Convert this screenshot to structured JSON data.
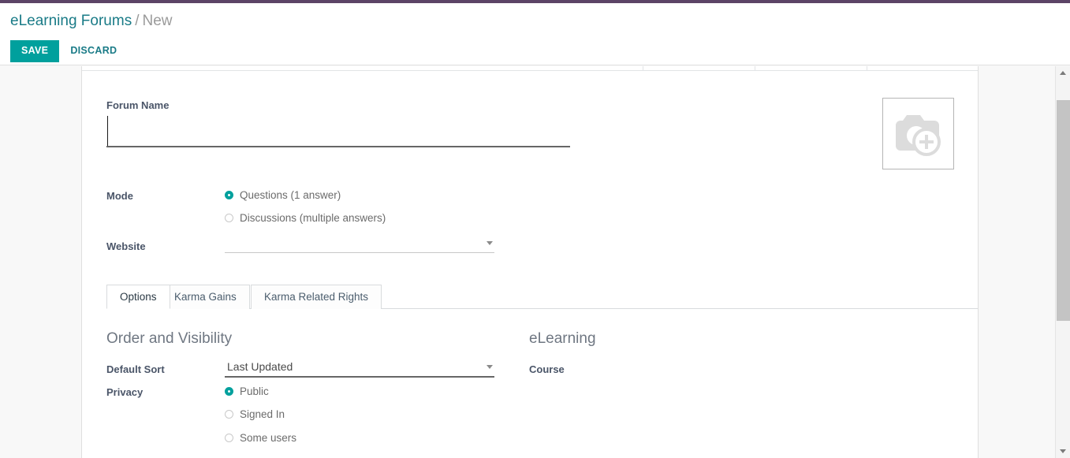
{
  "breadcrumb": {
    "root": "eLearning Forums",
    "separator": "/",
    "current": "New"
  },
  "control_panel": {
    "save_label": "SAVE",
    "discard_label": "DISCARD"
  },
  "colors": {
    "accent_teal": "#00a09d",
    "link_teal": "#1a7b87",
    "navbar_purple": "#5c4466",
    "label_gray": "#4a5568",
    "muted_gray": "#9a9a9a",
    "sheet_white": "#ffffff",
    "page_gray": "#f8f8f8"
  },
  "image_field": {
    "icon": "camera-plus-placeholder-icon",
    "alt": "Add image"
  },
  "form": {
    "name_label": "Forum Name",
    "name_value": "",
    "name_placeholder": "",
    "mode_label": "Mode",
    "mode_options": [
      {
        "label": "Questions (1 answer)",
        "selected": true
      },
      {
        "label": "Discussions (multiple answers)",
        "selected": false
      }
    ],
    "website_label": "Website",
    "website_value": "",
    "website_caret_icon": "chevron-down-icon"
  },
  "notebook": {
    "tabs": [
      {
        "label": "Options",
        "active": true
      },
      {
        "label": "Karma Gains",
        "active": false
      },
      {
        "label": "Karma Related Rights",
        "active": false
      }
    ]
  },
  "options_tab": {
    "left_group": {
      "title": "Order and Visibility",
      "default_sort_label": "Default Sort",
      "default_sort_value": "Last Updated",
      "default_sort_caret_icon": "chevron-down-icon",
      "privacy_label": "Privacy",
      "privacy_options": [
        {
          "label": "Public",
          "selected": true
        },
        {
          "label": "Signed In",
          "selected": false
        },
        {
          "label": "Some users",
          "selected": false
        }
      ]
    },
    "right_group": {
      "title": "eLearning",
      "course_label": "Course",
      "course_value": ""
    }
  },
  "scrollbar": {
    "up_icon": "chevron-up-icon",
    "down_icon": "chevron-down-icon",
    "thumb": "scroll-thumb"
  }
}
